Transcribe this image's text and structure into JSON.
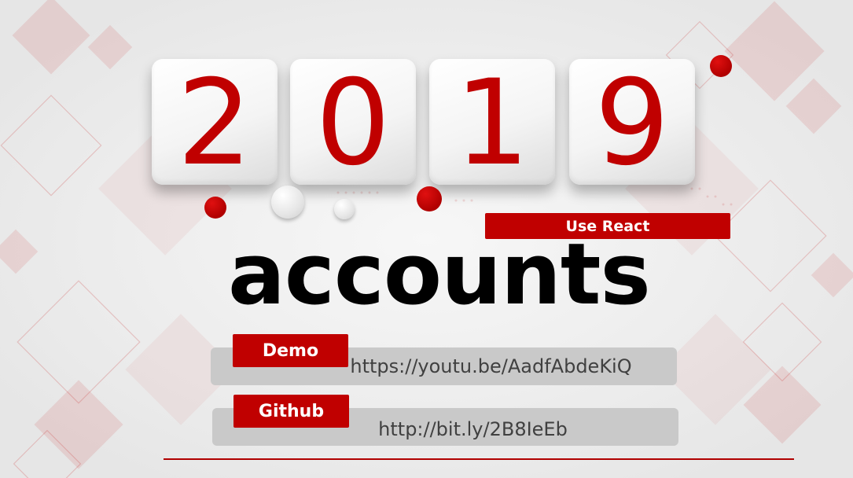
{
  "year_digits": [
    "2",
    "0",
    "1",
    "9"
  ],
  "tagline_badge": "Use React",
  "title": "accounts",
  "links": [
    {
      "label": "Demo",
      "url": "https://youtu.be/AadfAbdeKiQ"
    },
    {
      "label": "Github",
      "url": "http://bit.ly/2B8IeEb"
    }
  ],
  "colors": {
    "accent_red": "#c00000",
    "background": "#efefef",
    "link_box": "#c9c9c9",
    "title": "#000000"
  }
}
